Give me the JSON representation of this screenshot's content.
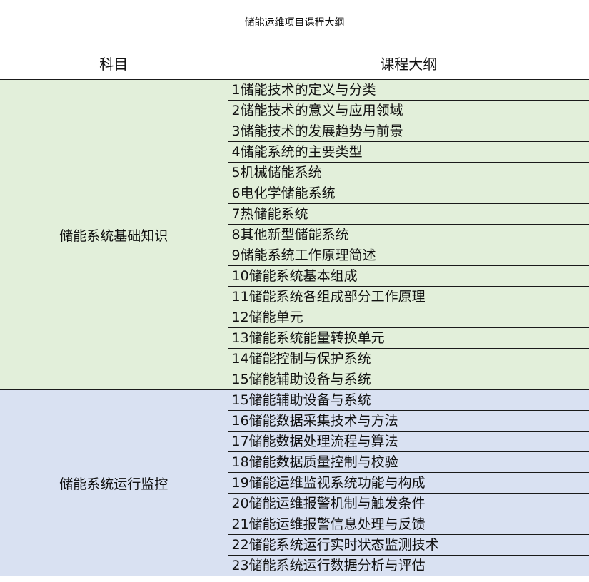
{
  "title": "储能运维项目课程大纲",
  "headers": {
    "subject": "科目",
    "outline": "课程大纲"
  },
  "colors": {
    "group1_fill": "#e2efda",
    "group2_fill": "#d9e1f2",
    "border": "#1a1a1a"
  },
  "groups": [
    {
      "subject": "储能系统基础知识",
      "items": [
        "1储能技术的定义与分类",
        "2储能技术的意义与应用领域",
        "3储能技术的发展趋势与前景",
        "4储能系统的主要类型",
        "5机械储能系统",
        "6电化学储能系统",
        "7热储能系统",
        "8其他新型储能系统",
        "9储能系统工作原理简述",
        "10储能系统基本组成",
        "11储能系统各组成部分工作原理",
        "12储能单元",
        "13储能系统能量转换单元",
        "14储能控制与保护系统",
        "15储能辅助设备与系统"
      ]
    },
    {
      "subject": "储能系统运行监控",
      "items": [
        "15储能辅助设备与系统",
        "16储能数据采集技术与方法",
        "17储能数据处理流程与算法",
        "18储能数据质量控制与校验",
        "19储能运维监视系统功能与构成",
        "20储能运维报警机制与触发条件",
        "21储能运维报警信息处理与反馈",
        "22储能系统运行实时状态监测技术",
        "23储能系统运行数据分析与评估"
      ]
    }
  ]
}
